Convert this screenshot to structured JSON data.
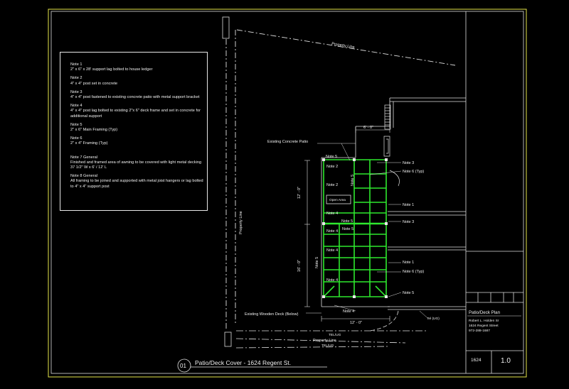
{
  "notes": [
    {
      "title": "Note 1",
      "body": "2\" x 6\" x 28' support lag bolted to house ledger"
    },
    {
      "title": "Note 2",
      "body": "4\" x 4\" post set in concrete"
    },
    {
      "title": "Note 3",
      "body": "4\" x 4\" post fastened to existing concrete patio with metal support bracket"
    },
    {
      "title": "Note 4",
      "body": "4\" x 4\" post lag bolted to existing 2\"x 6\" deck frame and set in concrete for additional support"
    },
    {
      "title": "Note 5",
      "body": "2\" x 6\" Main Framing (Typ)"
    },
    {
      "title": "Note 6",
      "body": "2\" x 4\" Framing (Typ)"
    },
    {
      "title": "Note 7 General",
      "body": "Finished and framed area of awning to be covered with light metal decking 37 1/2\" W x 6' / 12' L"
    },
    {
      "title": "Note 8 General",
      "body": "All framing to be joined and supported with metal joist hangers or lag bolted to 4\" x 4\" support post"
    }
  ],
  "plan": {
    "property_line_top": "Property Line",
    "property_line_left": "Property Line",
    "property_line_bottom": "Property Line",
    "tel_us_1": "TEL/UG",
    "tel_us_2": "TEL/UG",
    "tel_us_3": "Tel (UG)",
    "existing_patio": "Existing Concrete Patio",
    "existing_deck": "Existing Wooden Deck (Below)",
    "open_area": "Open Area",
    "dim_top": "6' - 0\"",
    "dim_bottom": "12' - 0\"",
    "dim_left_upper": "12' - 0\"",
    "dim_left_lower": "16' - 0\"",
    "inner_note_a": "Note 5",
    "inner_note_b": "Note 5",
    "callouts_left": [
      "Note 5",
      "Note 2",
      "Note 2",
      "Note 4",
      "Note 4",
      "Note 4",
      "Note 4",
      "Note 5",
      "Note 5"
    ],
    "callouts_right": [
      "Note 3",
      "Note 6 (Typ)",
      "Note 1",
      "Note 3",
      "Note 1",
      "Note 6 (Typ)",
      "Note 5"
    ],
    "bottom_callout": "Note 4",
    "accent_green": "#2ee82e",
    "line_color": "#e8e8e8"
  },
  "caption": {
    "number": "01",
    "title": "Patio/Deck Cover  -  1624 Regent St."
  },
  "title_block": {
    "drawing_title": "Patio/Deck Plan",
    "owner": "Robert L. Holden Sr",
    "address": "1624 Regent Street",
    "phone": "972-288-1687",
    "sheet_id": "1624",
    "revision": "1.0"
  }
}
